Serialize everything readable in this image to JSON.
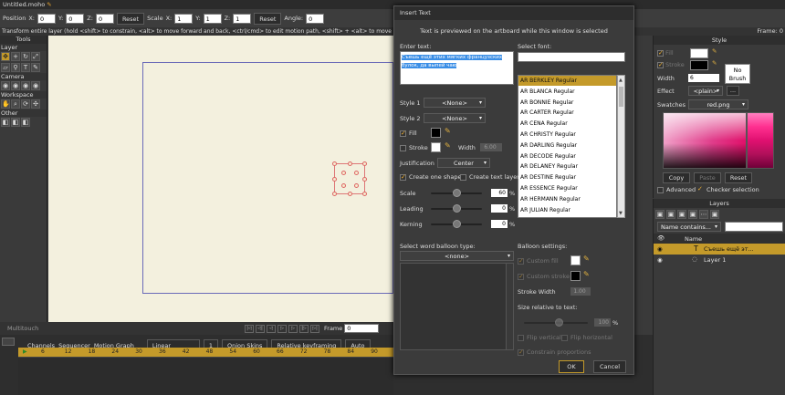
{
  "app": {
    "title": "Untitled.moho"
  },
  "toolbar": {
    "position_label": "Position",
    "x_label": "X:",
    "x_value": "0",
    "y_label": "Y:",
    "y_value": "0",
    "z_label": "Z:",
    "z_value": "0",
    "reset1": "Reset",
    "scale_label": "Scale",
    "sx_label": "X:",
    "sx_value": "1",
    "sy_label": "Y:",
    "sy_value": "1",
    "sz_label": "Z:",
    "sz_value": "1",
    "reset2": "Reset",
    "angle_label": "Angle:",
    "angle_value": "0"
  },
  "hint": "Transform entire layer (hold <shift> to constrain, <alt> to move forward and back, <ctrl/cmd> to edit motion path, <shift> + <alt> to move in Z and r",
  "tools": {
    "title": "Tools",
    "sections": [
      "Layer",
      "Camera",
      "Workspace",
      "Other"
    ]
  },
  "canvas_bottom": {
    "multitouch": "Multitouch",
    "frame_label": "Frame",
    "frame_value": "0"
  },
  "timeline": {
    "tabs": [
      "Channels",
      "Sequencer",
      "Motion Graph"
    ],
    "interp": "Linear",
    "step": "1",
    "onion": "Onion Skins",
    "relative": "Relative keyframing",
    "auto": "Auto",
    "ruler": [
      "6",
      "12",
      "18",
      "24",
      "30",
      "36",
      "42",
      "48",
      "54",
      "60",
      "66",
      "72",
      "78",
      "84",
      "90"
    ]
  },
  "right": {
    "frame_text": "Frame: 0",
    "style_title": "Style",
    "fill_label": "Fill",
    "stroke_label": "Stroke",
    "no_brush": "No Brush",
    "width_label": "Width",
    "width_value": "6",
    "effect_label": "Effect",
    "effect_value": "<plain>",
    "swatches_label": "Swatches",
    "swatches_value": "red.png",
    "copy": "Copy",
    "paste": "Paste",
    "reset": "Reset",
    "advanced": "Advanced",
    "checker": "Checker selection",
    "layers_title": "Layers",
    "name_filter": "Name contains...",
    "name_col": "Name",
    "layer_text": "Съешь ещё эт...",
    "layer1": "Layer 1"
  },
  "dialog": {
    "title": "Insert Text",
    "subtitle": "Text is previewed on the artboard while this window is selected",
    "enter_text_label": "Enter text:",
    "text_value": "Съешь ещё этих мягких французских булок, да выпей чаю",
    "select_font_label": "Select font:",
    "fonts": [
      "AR BERKLEY Regular",
      "AR BLANCA Regular",
      "AR BONNIE Regular",
      "AR CARTER Regular",
      "AR CENA Regular",
      "AR CHRISTY Regular",
      "AR DARLING Regular",
      "AR DECODE Regular",
      "AR DELANEY Regular",
      "AR DESTINE Regular",
      "AR ESSENCE Regular",
      "AR HERMANN Regular",
      "AR JULIAN Regular"
    ],
    "style1_label": "Style 1",
    "style1_value": "<None>",
    "style2_label": "Style 2",
    "style2_value": "<None>",
    "fill_label": "Fill",
    "stroke_label": "Stroke",
    "width_label": "Width",
    "width_value": "6.00",
    "justification_label": "Justification",
    "justification_value": "Center",
    "create_one_shape": "Create one shape",
    "create_text_layer": "Create text layer",
    "scale_label": "Scale",
    "scale_value": "60",
    "leading_label": "Leading",
    "leading_value": "0",
    "kerning_label": "Kerning",
    "kerning_value": "0",
    "percent": "%",
    "balloon_type_label": "Select word balloon type:",
    "balloon_type_value": "<none>",
    "balloon_settings_label": "Balloon settings:",
    "custom_fill": "Custom fill",
    "custom_stroke": "Custom stroke",
    "stroke_width_label": "Stroke Width",
    "stroke_width_value": "1.00",
    "size_rel_label": "Size relative to text:",
    "size_rel_value": "100",
    "flip_v": "Flip vertical",
    "flip_h": "Flip horizontal",
    "constrain": "Constrain proportions",
    "ok": "OK",
    "cancel": "Cancel"
  },
  "colors": {
    "accent": "#c49a2a",
    "canvas": "#f3f0de",
    "frame": "#6a6ab8"
  }
}
